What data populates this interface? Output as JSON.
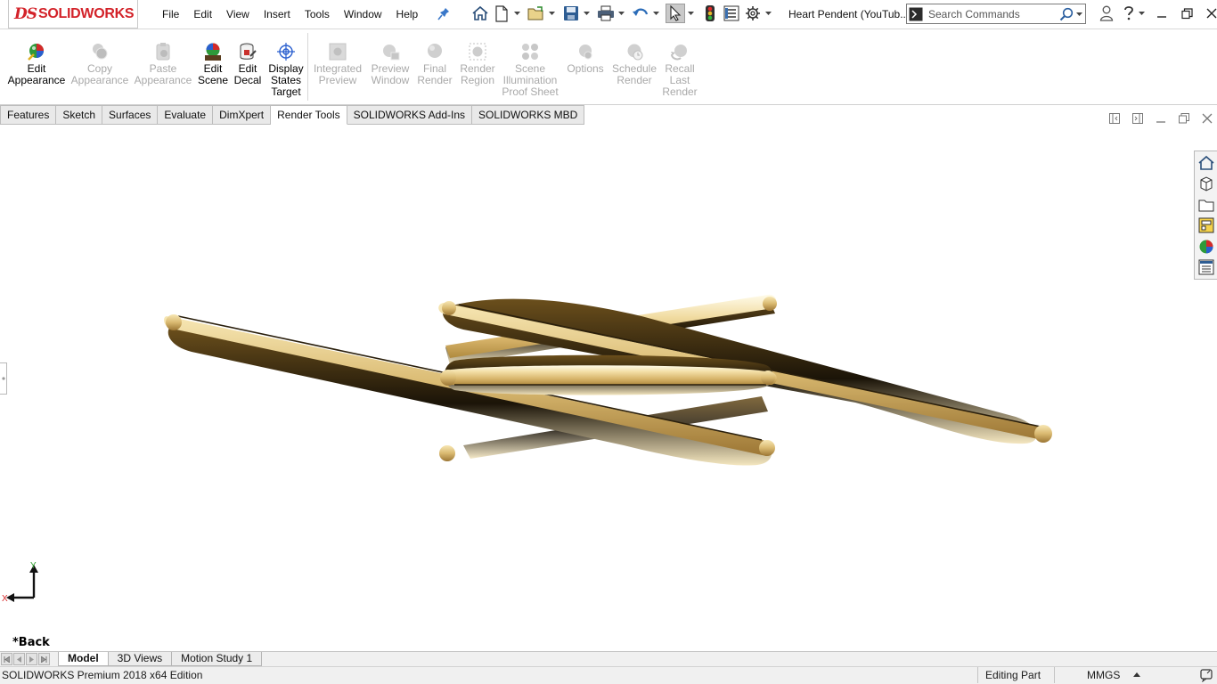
{
  "app": {
    "logo_prefix": "DS",
    "logo_text": "SOLIDWORKS",
    "document_title": "Heart Pendent (YouTub..."
  },
  "menu": [
    "File",
    "Edit",
    "View",
    "Insert",
    "Tools",
    "Window",
    "Help"
  ],
  "search": {
    "placeholder": "Search Commands"
  },
  "ribbon": {
    "buttons": [
      {
        "label": [
          "Edit",
          "Appearance"
        ],
        "enabled": true,
        "icon": "edit-appearance-icon"
      },
      {
        "label": [
          "Copy",
          "Appearance"
        ],
        "enabled": false,
        "icon": "copy-appearance-icon"
      },
      {
        "label": [
          "Paste",
          "Appearance"
        ],
        "enabled": false,
        "icon": "paste-appearance-icon"
      },
      {
        "label": [
          "Edit",
          "Scene"
        ],
        "enabled": true,
        "icon": "edit-scene-icon"
      },
      {
        "label": [
          "Edit",
          "Decal"
        ],
        "enabled": true,
        "icon": "edit-decal-icon"
      },
      {
        "label": [
          "Display",
          "States",
          "Target"
        ],
        "enabled": true,
        "icon": "display-states-target-icon"
      },
      {
        "label": [
          "Integrated",
          "Preview"
        ],
        "enabled": false,
        "icon": "integrated-preview-icon"
      },
      {
        "label": [
          "Preview",
          "Window"
        ],
        "enabled": false,
        "icon": "preview-window-icon"
      },
      {
        "label": [
          "Final",
          "Render"
        ],
        "enabled": false,
        "icon": "final-render-icon"
      },
      {
        "label": [
          "Render",
          "Region"
        ],
        "enabled": false,
        "icon": "render-region-icon"
      },
      {
        "label": [
          "Scene",
          "Illumination",
          "Proof Sheet"
        ],
        "enabled": false,
        "icon": "scene-illumination-icon"
      },
      {
        "label": [
          "Options"
        ],
        "enabled": false,
        "icon": "options-icon"
      },
      {
        "label": [
          "Schedule",
          "Render"
        ],
        "enabled": false,
        "icon": "schedule-render-icon"
      },
      {
        "label": [
          "Recall",
          "Last",
          "Render"
        ],
        "enabled": false,
        "icon": "recall-last-render-icon"
      }
    ]
  },
  "tabs": [
    "Features",
    "Sketch",
    "Surfaces",
    "Evaluate",
    "DimXpert",
    "Render Tools",
    "SOLIDWORKS Add-Ins",
    "SOLIDWORKS MBD"
  ],
  "active_tab": "Render Tools",
  "viewport": {
    "view_name": "*Back",
    "triad": {
      "y_label": "Y",
      "x_label": "X"
    }
  },
  "bottom_tabs": [
    "Model",
    "3D Views",
    "Motion Study 1"
  ],
  "active_bottom_tab": "Model",
  "status": {
    "edition": "SOLIDWORKS Premium 2018 x64 Edition",
    "mode": "Editing Part",
    "units": "MMGS"
  },
  "colors": {
    "brand_red": "#d3232a",
    "gold_light": "#f6e7b6",
    "gold_mid": "#d6b66e",
    "gold_dark": "#8a6a2a"
  }
}
